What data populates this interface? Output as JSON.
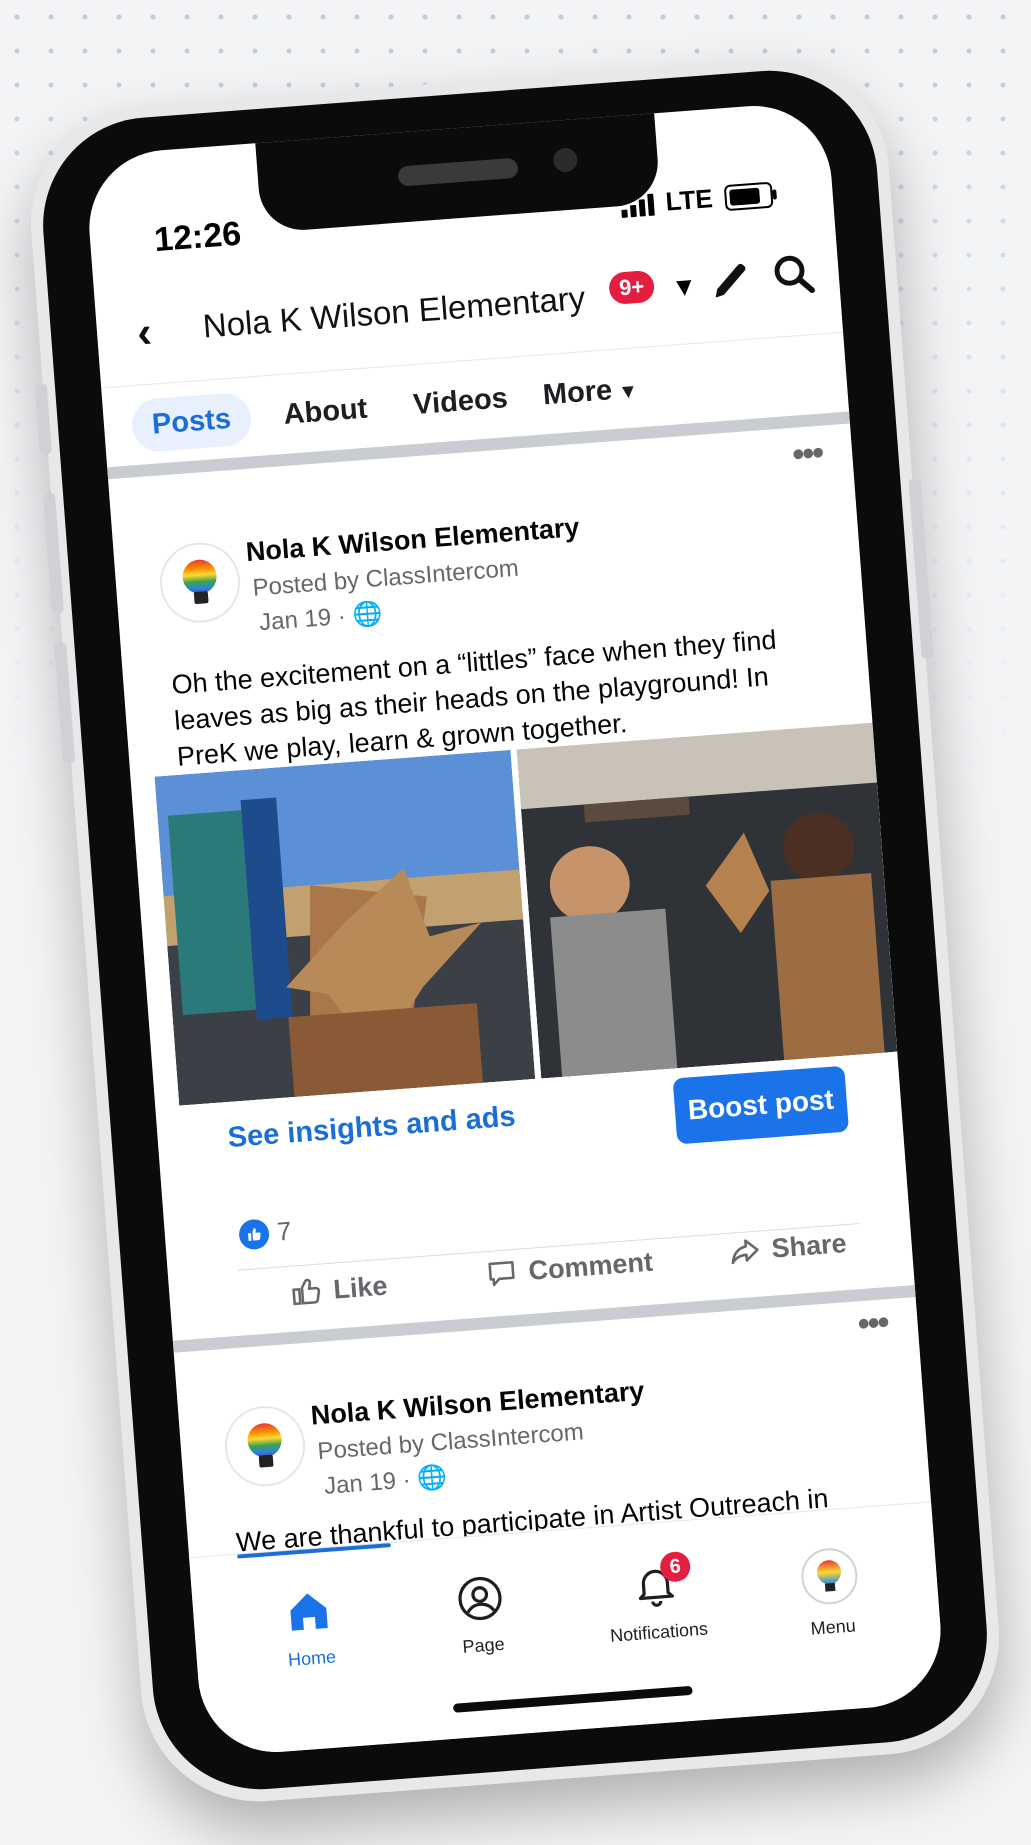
{
  "status_bar": {
    "time": "12:26",
    "network": "LTE"
  },
  "header": {
    "title": "Nola K Wilson Elementary",
    "badge": "9+"
  },
  "tabs": [
    {
      "label": "Posts"
    },
    {
      "label": "About"
    },
    {
      "label": "Videos"
    },
    {
      "label": "More"
    }
  ],
  "posts": [
    {
      "author": "Nola K Wilson Elementary",
      "posted_by": "Posted by ClassIntercom",
      "date": "Jan 19 · ",
      "text": "Oh the excitement on a “littles” face when they find leaves as big as their heads on the playground!  In PreK we play, learn & grown together.",
      "insights_label": "See insights and ads",
      "boost_label": "Boost post",
      "likes": "7",
      "actions": {
        "like": "Like",
        "comment": "Comment",
        "share": "Share"
      }
    },
    {
      "author": "Nola K Wilson Elementary",
      "posted_by": "Posted by ClassIntercom",
      "date": "Jan 19 · ",
      "text": "We are thankful to participate in Artist Outreach in PreK! Ms. Adairs Class enjoying drums."
    }
  ],
  "bottom_nav": [
    {
      "label": "Home"
    },
    {
      "label": "Page"
    },
    {
      "label": "Notifications",
      "badge": "6"
    },
    {
      "label": "Menu"
    }
  ],
  "colors": {
    "accent": "#1a73e8",
    "badge": "#e41e3f"
  },
  "icons": [
    "back-arrow-icon",
    "pencil-icon",
    "search-icon",
    "globe-icon",
    "like-icon",
    "comment-icon",
    "share-icon",
    "home-icon",
    "profile-icon",
    "bell-icon",
    "more-dots-icon"
  ]
}
